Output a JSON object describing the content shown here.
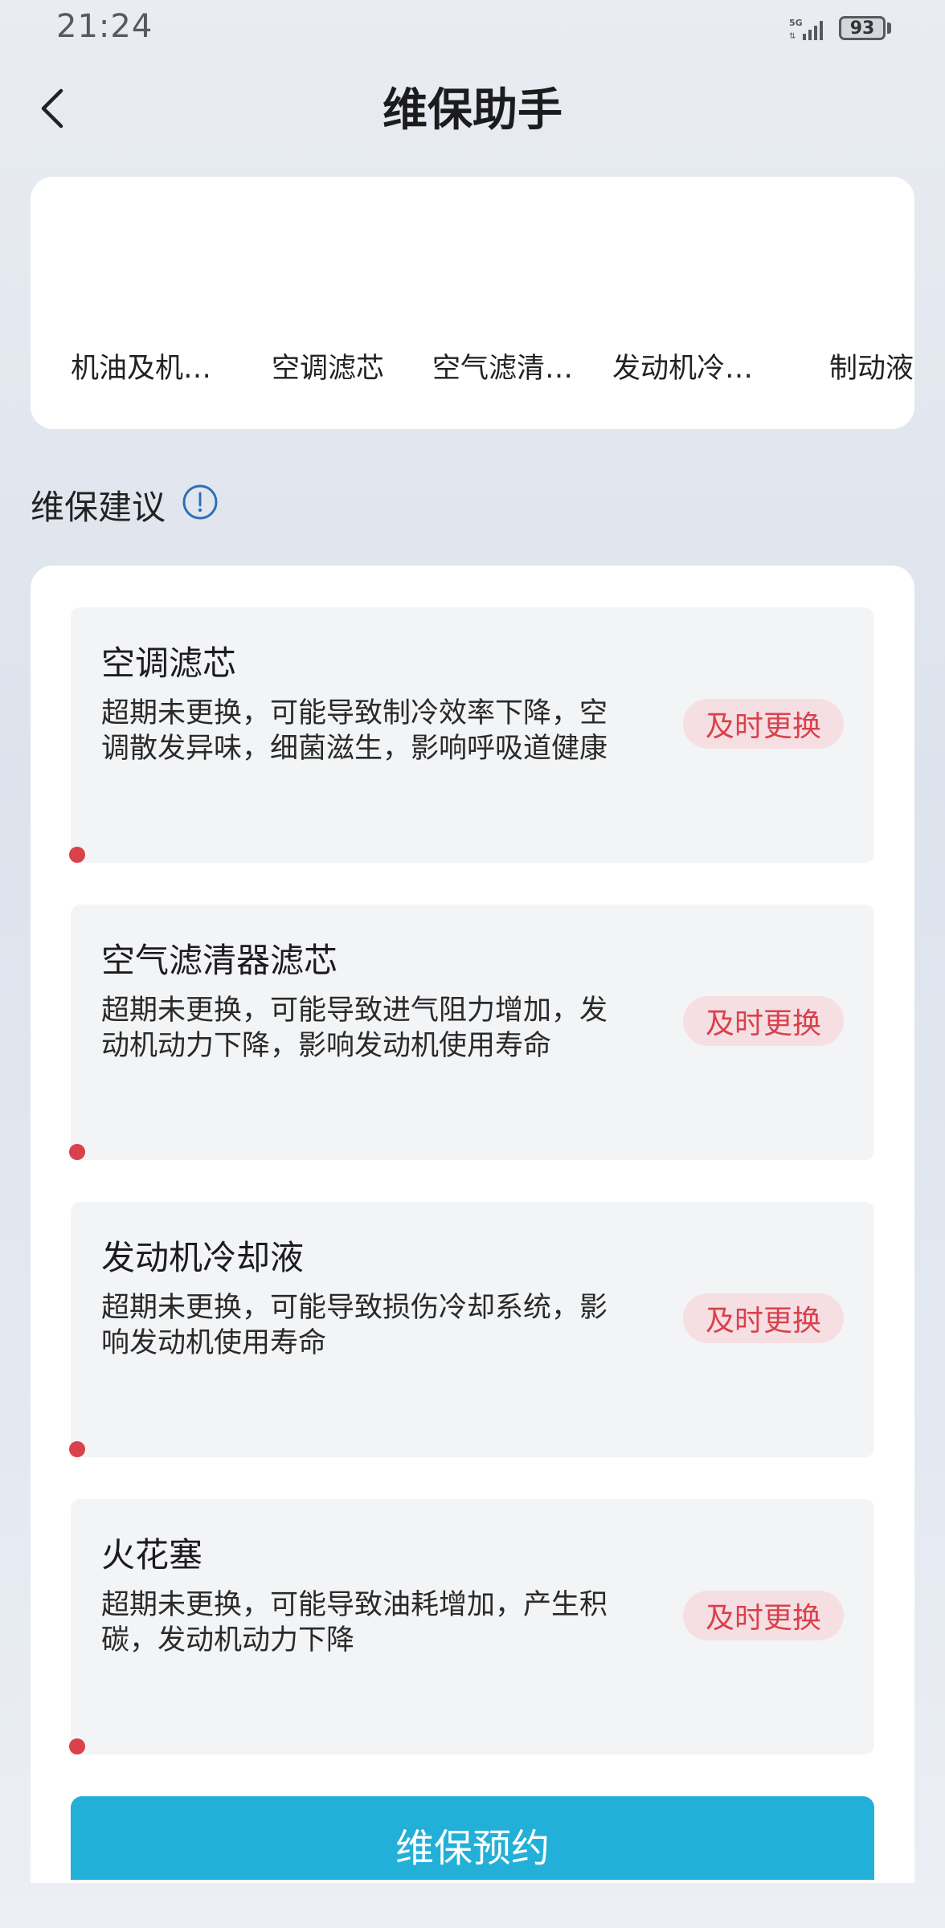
{
  "status_bar": {
    "time": "21:24",
    "network": "5G",
    "battery": "93"
  },
  "header": {
    "title": "维保助手",
    "back_icon": "chevron-left-icon"
  },
  "categories": [
    {
      "label": "机油及机…"
    },
    {
      "label": "空调滤芯"
    },
    {
      "label": "空气滤清…"
    },
    {
      "label": "发动机冷…"
    },
    {
      "label": "制动液"
    }
  ],
  "advice_section": {
    "title": "维保建议",
    "info_icon": "info-circle-icon",
    "badge_color": "#d9414c",
    "items": [
      {
        "title": "空调滤芯",
        "description": "超期未更换，可能导致制冷效率下降，空调散发异味，细菌滋生，影响呼吸道健康",
        "badge": "及时更换"
      },
      {
        "title": "空气滤清器滤芯",
        "description": "超期未更换，可能导致进气阻力增加，发动机动力下降，影响发动机使用寿命",
        "badge": "及时更换"
      },
      {
        "title": "发动机冷却液",
        "description": "超期未更换，可能导致损伤冷却系统，影响发动机使用寿命",
        "badge": "及时更换"
      },
      {
        "title": "火花塞",
        "description": "超期未更换，可能导致油耗增加，产生积碳，发动机动力下降",
        "badge": "及时更换"
      }
    ]
  },
  "footer": {
    "button_label": "维保预约",
    "button_color": "#22b0d8"
  }
}
